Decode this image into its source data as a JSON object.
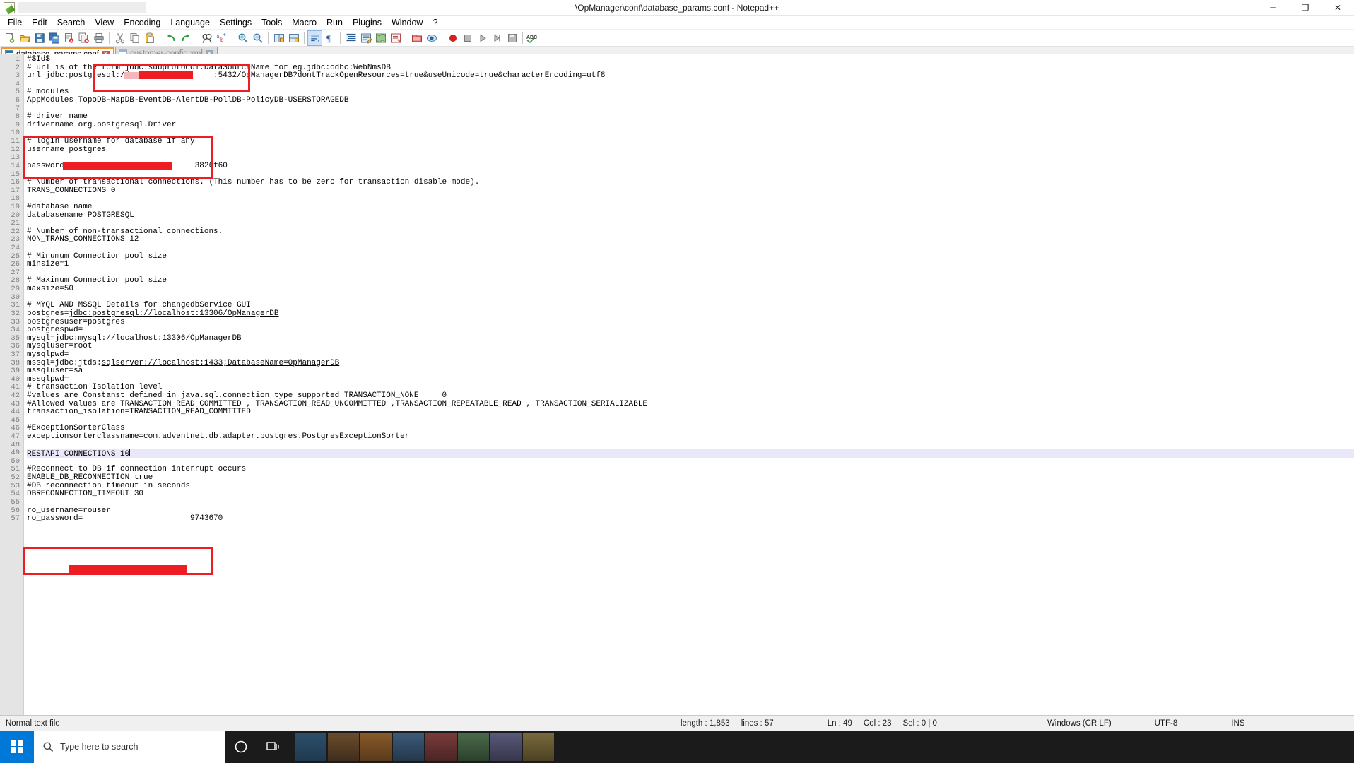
{
  "window": {
    "title": "\\OpManager\\conf\\database_params.conf - Notepad++",
    "app_icon": "notepad-plus-plus-icon",
    "buttons": {
      "minimize": "─",
      "maximize": "❐",
      "close": "✕"
    }
  },
  "menubar": {
    "items": [
      {
        "label": "File"
      },
      {
        "label": "Edit"
      },
      {
        "label": "Search"
      },
      {
        "label": "View"
      },
      {
        "label": "Encoding"
      },
      {
        "label": "Language"
      },
      {
        "label": "Settings"
      },
      {
        "label": "Tools"
      },
      {
        "label": "Macro"
      },
      {
        "label": "Run"
      },
      {
        "label": "Plugins"
      },
      {
        "label": "Window"
      },
      {
        "label": "?"
      }
    ]
  },
  "toolbar": {
    "icons": [
      "new-file-icon",
      "open-file-icon",
      "save-icon",
      "save-all-icon",
      "close-file-icon",
      "close-all-icon",
      "print-icon",
      "cut-icon",
      "copy-icon",
      "paste-icon",
      "undo-icon",
      "redo-icon",
      "find-icon",
      "replace-icon",
      "zoom-in-icon",
      "zoom-out-icon",
      "sync-vertical-scrolling-icon",
      "sync-horizontal-scrolling-icon",
      "word-wrap-icon",
      "show-all-characters-icon",
      "indent-guide-icon",
      "user-defined-language-icon",
      "document-map-icon",
      "function-list-icon",
      "folder-as-workspace-icon",
      "monitoring-icon",
      "start-recording-icon",
      "stop-recording-icon",
      "playback-icon",
      "run-macro-multiple-icon",
      "save-macro-icon",
      "spell-check-icon"
    ]
  },
  "tabs": [
    {
      "label": "database_params.conf",
      "active": true,
      "close": "✕"
    },
    {
      "label": "customer-config.xml",
      "active": false,
      "close": "✕"
    }
  ],
  "editor": {
    "current_line": 49,
    "lines": [
      {
        "n": 1,
        "text": "#$Id$"
      },
      {
        "n": 2,
        "text": "# url is of the form jdbc:subprotocol:DataSourceName for eg.jdbc:odbc:WebNmsDB"
      },
      {
        "n": 3,
        "text": "url jdbc:postgresql://r                 :5432/OpManagerDB?dontTrackOpenResources=true&useUnicode=true&characterEncoding=utf8"
      },
      {
        "n": 4,
        "text": ""
      },
      {
        "n": 5,
        "text": "# modules"
      },
      {
        "n": 6,
        "text": "AppModules TopoDB-MapDB-EventDB-AlertDB-PollDB-PolicyDB-USERSTORAGEDB"
      },
      {
        "n": 7,
        "text": ""
      },
      {
        "n": 8,
        "text": "# driver name"
      },
      {
        "n": 9,
        "text": "drivername org.postgresql.Driver"
      },
      {
        "n": 10,
        "text": ""
      },
      {
        "n": 11,
        "text": "# login username for database if any"
      },
      {
        "n": 12,
        "text": "username postgres"
      },
      {
        "n": 13,
        "text": ""
      },
      {
        "n": 14,
        "text": "password=                           3826f60"
      },
      {
        "n": 15,
        "text": ""
      },
      {
        "n": 16,
        "text": "# Number of transactional connections. (This number has to be zero for transaction disable mode)."
      },
      {
        "n": 17,
        "text": "TRANS_CONNECTIONS 0"
      },
      {
        "n": 18,
        "text": ""
      },
      {
        "n": 19,
        "text": "#database name"
      },
      {
        "n": 20,
        "text": "databasename POSTGRESQL"
      },
      {
        "n": 21,
        "text": ""
      },
      {
        "n": 22,
        "text": "# Number of non-transactional connections."
      },
      {
        "n": 23,
        "text": "NON_TRANS_CONNECTIONS 12"
      },
      {
        "n": 24,
        "text": ""
      },
      {
        "n": 25,
        "text": "# Minumum Connection pool size"
      },
      {
        "n": 26,
        "text": "minsize=1"
      },
      {
        "n": 27,
        "text": ""
      },
      {
        "n": 28,
        "text": "# Maximum Connection pool size"
      },
      {
        "n": 29,
        "text": "maxsize=50"
      },
      {
        "n": 30,
        "text": ""
      },
      {
        "n": 31,
        "text": "# MYQL AND MSSQL Details for changedbService GUI"
      },
      {
        "n": 32,
        "text": "postgres=jdbc:postgresql://localhost:13306/OpManagerDB"
      },
      {
        "n": 33,
        "text": "postgresuser=postgres"
      },
      {
        "n": 34,
        "text": "postgrespwd="
      },
      {
        "n": 35,
        "text": "mysql=jdbc:mysql://localhost:13306/OpManagerDB"
      },
      {
        "n": 36,
        "text": "mysqluser=root"
      },
      {
        "n": 37,
        "text": "mysqlpwd="
      },
      {
        "n": 38,
        "text": "mssql=jdbc:jtds:sqlserver://localhost:1433;DatabaseName=OpManagerDB"
      },
      {
        "n": 39,
        "text": "mssqluser=sa"
      },
      {
        "n": 40,
        "text": "mssqlpwd="
      },
      {
        "n": 41,
        "text": "# transaction Isolation level"
      },
      {
        "n": 42,
        "text": "#values are Constanst defined in java.sql.connection type supported TRANSACTION_NONE     0"
      },
      {
        "n": 43,
        "text": "#Allowed values are TRANSACTION_READ_COMMITTED , TRANSACTION_READ_UNCOMMITTED ,TRANSACTION_REPEATABLE_READ , TRANSACTION_SERIALIZABLE"
      },
      {
        "n": 44,
        "text": "transaction_isolation=TRANSACTION_READ_COMMITTED"
      },
      {
        "n": 45,
        "text": ""
      },
      {
        "n": 46,
        "text": "#ExceptionSorterClass"
      },
      {
        "n": 47,
        "text": "exceptionsorterclassname=com.adventnet.db.adapter.postgres.PostgresExceptionSorter"
      },
      {
        "n": 48,
        "text": ""
      },
      {
        "n": 49,
        "text": "RESTAPI_CONNECTIONS 10"
      },
      {
        "n": 50,
        "text": ""
      },
      {
        "n": 51,
        "text": "#Reconnect to DB if connection interrupt occurs"
      },
      {
        "n": 52,
        "text": "ENABLE_DB_RECONNECTION true"
      },
      {
        "n": 53,
        "text": "#DB reconnection timeout in seconds"
      },
      {
        "n": 54,
        "text": "DBRECONNECTION_TIMEOUT 30"
      },
      {
        "n": 55,
        "text": ""
      },
      {
        "n": 56,
        "text": "ro_username=rouser"
      },
      {
        "n": 57,
        "text": "ro_password=                       9743670"
      }
    ],
    "redactions": [
      {
        "name": "host-redaction-pink",
        "color": "#f2b8bc"
      },
      {
        "name": "host-redaction-red",
        "color": "#ee1d23"
      },
      {
        "name": "password-redaction",
        "color": "#ee1d23"
      },
      {
        "name": "ro-password-redaction",
        "color": "#ee1d23"
      }
    ],
    "annotations": [
      {
        "name": "url-highlight-box",
        "color": "#ee1d23"
      },
      {
        "name": "credentials-highlight-box",
        "color": "#ee1d23"
      },
      {
        "name": "readonly-credentials-highlight-box",
        "color": "#ee1d23"
      }
    ]
  },
  "statusbar": {
    "file_type": "Normal text file",
    "length_label": "length : 1,853",
    "lines_label": "lines : 57",
    "ln": "Ln : 49",
    "col": "Col : 23",
    "sel": "Sel : 0 | 0",
    "eol": "Windows (CR LF)",
    "encoding": "UTF-8",
    "insert_mode": "INS"
  },
  "taskbar": {
    "start": "start-button",
    "search_placeholder": "Type here to search",
    "search_icon": "search-icon",
    "cortana_icon": "cortana-circle-icon",
    "taskview_icon": "task-view-icon"
  },
  "colors": {
    "accent_red": "#ee1d23",
    "tab_active_top": "#f29a2e",
    "current_line": "#e8e8f8",
    "taskbar_bg": "#1b1b1b",
    "start_blue": "#0078d7"
  }
}
